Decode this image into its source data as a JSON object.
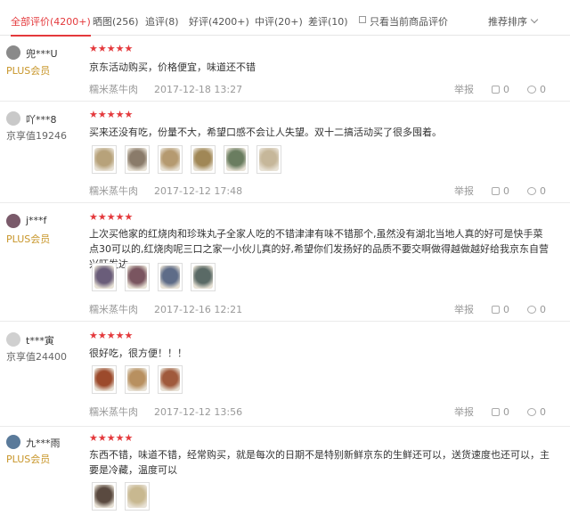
{
  "tabs": [
    {
      "label": "全部评价(4200+)"
    },
    {
      "label": "晒图(256)"
    },
    {
      "label": "追评(8)"
    },
    {
      "label": "好评(4200+)"
    },
    {
      "label": "中评(20+)"
    },
    {
      "label": "差评(10)"
    }
  ],
  "filter_label": "只看当前商品评价",
  "sort_label": "推荐排序",
  "report_label": "举报",
  "reviews": [
    {
      "username": "兜***U",
      "level": "PLUS会员",
      "stars": "★★★★★",
      "content": "京东活动购买，价格便宜，味道还不错",
      "product": "糯米蒸牛肉",
      "date": "2017-12-18 13:27",
      "likes": "0",
      "replies": "0",
      "image_colors": []
    },
    {
      "username": "吖***8",
      "level": "京享值19246",
      "stars": "★★★★★",
      "content": "买来还没有吃，份量不大，希望口感不会让人失望。双十二搞活动买了很多囤着。",
      "product": "糯米蒸牛肉",
      "date": "2017-12-12 17:48",
      "likes": "0",
      "replies": "0",
      "image_colors": [
        "#b7a27a",
        "#8a7b6a",
        "#b59a70",
        "#a08756",
        "#6a7d60",
        "#c6b79a"
      ]
    },
    {
      "username": "j***f",
      "level": "PLUS会员",
      "stars": "★★★★★",
      "content": "上次买他家的红烧肉和珍珠丸子全家人吃的不错津津有味不错那个,虽然没有湖北当地人真的好可是快手菜点30可以的,红烧肉呢三口之家一小伙儿真的好,希望你们发扬好的品质不要交啊做得越做越好给我京东自营兴旺发达",
      "product": "糯米蒸牛肉",
      "date": "2017-12-16 12:21",
      "likes": "0",
      "replies": "0",
      "image_colors": [
        "#6a5d7a",
        "#7a5560",
        "#5e6c88",
        "#5a6a66"
      ]
    },
    {
      "username": "t***寅",
      "level": "京享值24400",
      "stars": "★★★★★",
      "content": "很好吃，很方便！！！",
      "product": "糯米蒸牛肉",
      "date": "2017-12-12 13:56",
      "likes": "0",
      "replies": "0",
      "image_colors": [
        "#9c4a2c",
        "#b89060",
        "#a05a3c"
      ]
    },
    {
      "username": "九***雨",
      "level": "PLUS会员",
      "stars": "★★★★★",
      "content": "东西不错，味道不错，经常购买，就是每次的日期不是特别新鲜京东的生鲜还可以，送货速度也还可以，主要是冷藏，温度可以",
      "product": "",
      "date": "",
      "likes": "",
      "replies": "",
      "image_colors": [
        "#5a4a40",
        "#c8b890"
      ]
    }
  ]
}
